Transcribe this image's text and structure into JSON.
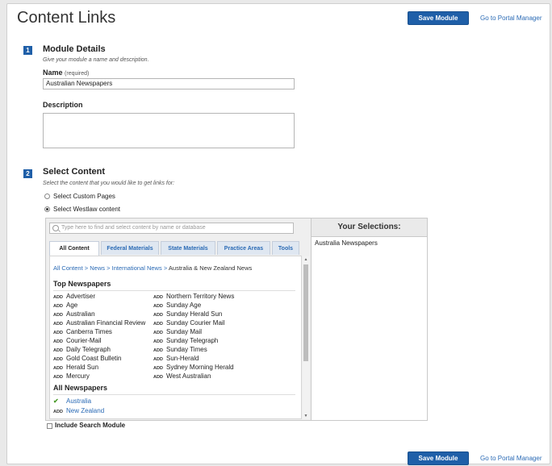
{
  "header": {
    "title": "Content Links",
    "save_label": "Save Module",
    "portal_link": "Go to Portal Manager"
  },
  "module_details": {
    "step": "1",
    "title": "Module Details",
    "hint": "Give your module a name and description.",
    "name_label": "Name",
    "name_required": "(required)",
    "name_value": "Australian Newspapers",
    "description_label": "Description",
    "description_value": ""
  },
  "select_content": {
    "step": "2",
    "title": "Select Content",
    "hint": "Select the content that you would like to get links for:",
    "options": [
      {
        "label": "Select Custom Pages",
        "selected": false
      },
      {
        "label": "Select Westlaw content",
        "selected": true
      }
    ],
    "search_placeholder": "Type here to find and select content by name or database",
    "tabs": [
      "All Content",
      "Federal Materials",
      "State Materials",
      "Practice Areas",
      "Tools"
    ],
    "active_tab": "All Content",
    "breadcrumb": [
      "All Content",
      "News",
      "International News",
      "Australia & New Zealand News"
    ],
    "breadcrumb_sep": ">",
    "add_label": "ADD",
    "top_newspapers_title": "Top Newspapers",
    "top_newspapers_col1": [
      "Advertiser",
      "Age",
      "Australian",
      "Australian Financial Review",
      "Canberra Times",
      "Courier-Mail",
      "Daily Telegraph",
      "Gold Coast Bulletin",
      "Herald Sun",
      "Mercury"
    ],
    "top_newspapers_col2": [
      "Northern Territory News",
      "Sunday Age",
      "Sunday Herald Sun",
      "Sunday Courier Mail",
      "Sunday Mail",
      "Sunday Telegraph",
      "Sunday Times",
      "Sun-Herald",
      "Sydney Morning Herald",
      "West Australian"
    ],
    "all_newspapers_title": "All Newspapers",
    "all_newspapers": [
      {
        "label": "Australia",
        "added": true
      },
      {
        "label": "New Zealand",
        "added": false
      }
    ],
    "selections_title": "Your Selections:",
    "selections": [
      "Australia Newspapers"
    ],
    "include_search_label": "Include Search Module",
    "include_search_checked": false
  },
  "footer": {
    "save_label": "Save Module",
    "portal_link": "Go to Portal Manager"
  }
}
